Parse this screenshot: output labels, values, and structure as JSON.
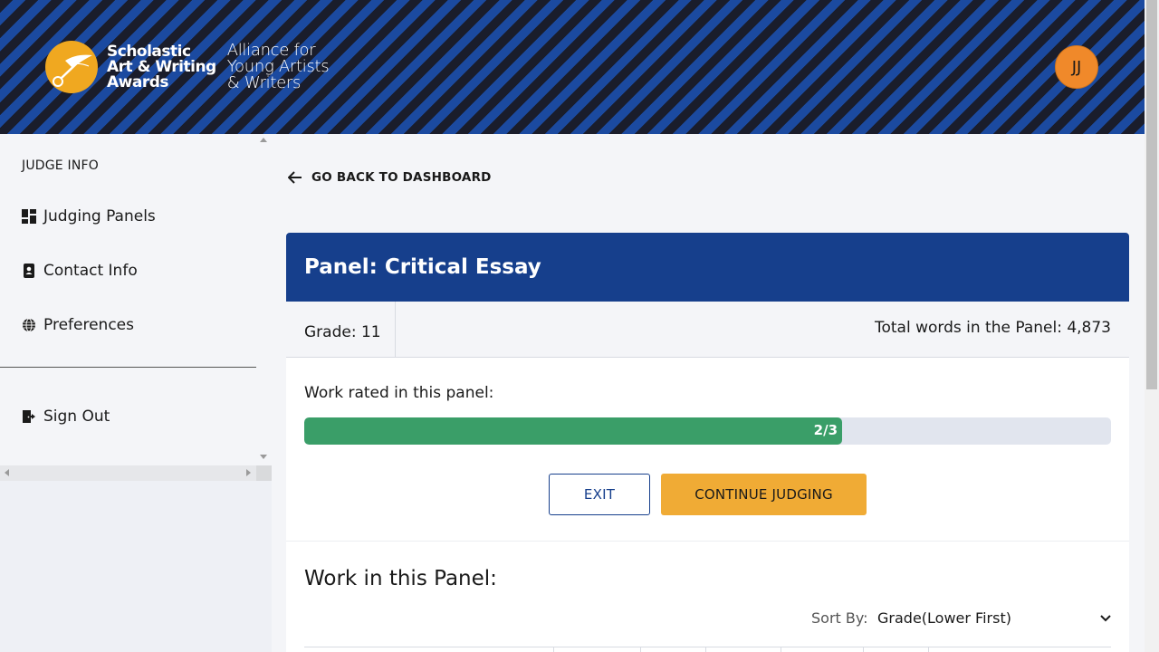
{
  "header": {
    "logo_line1": "Scholastic",
    "logo_line2": "Art & Writing",
    "logo_line3": "Awards",
    "alliance_line1": "Alliance for",
    "alliance_line2": "Young Artists",
    "alliance_line3": "& Writers",
    "avatar_initials": "JJ"
  },
  "sidebar": {
    "heading": "JUDGE INFO",
    "items": [
      {
        "label": "Judging Panels",
        "icon": "dashboard-icon"
      },
      {
        "label": "Contact Info",
        "icon": "contact-card-icon"
      },
      {
        "label": "Preferences",
        "icon": "globe-icon"
      }
    ],
    "sign_out": {
      "label": "Sign Out",
      "icon": "sign-out-icon"
    }
  },
  "main": {
    "back_label": "GO BACK TO DASHBOARD",
    "panel_title": "Panel: Critical Essay",
    "grade": "Grade: 11",
    "total_words": "Total words in the Panel: 4,873",
    "rated_label": "Work rated in this panel:",
    "progress": {
      "text": "2/3",
      "fraction": 0.6667
    },
    "exit_label": "EXIT",
    "continue_label": "CONTINUE JUDGING",
    "work_title": "Work in this Panel:",
    "sort_label": "Sort By:",
    "sort_value": "Grade(Lower First)"
  },
  "colors": {
    "header_blue": "#1b4aa0",
    "header_dark": "#1a1d2b",
    "panel_blue": "#163f8c",
    "progress_green": "#3a9e68",
    "accent_orange": "#f0ab35",
    "avatar_orange": "#f0892a"
  }
}
